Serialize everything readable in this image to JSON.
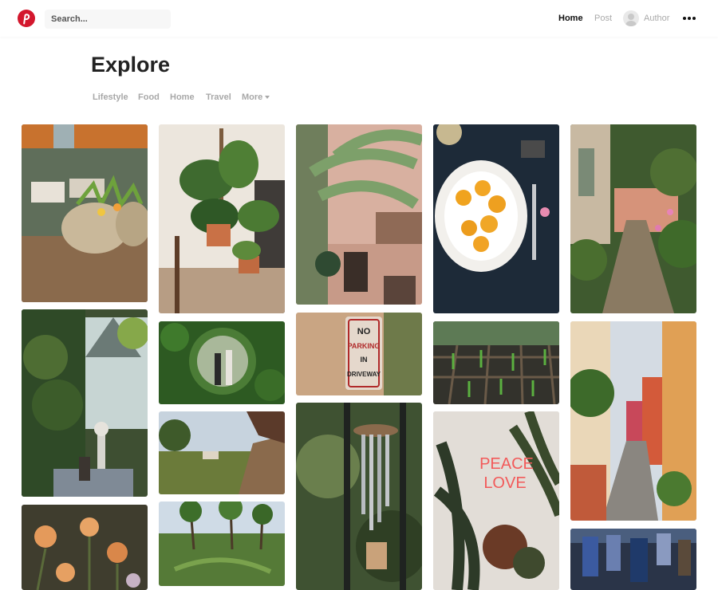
{
  "header": {
    "logo_icon": "pinterest-p-logo",
    "search_placeholder": "Search...",
    "nav": {
      "home": "Home",
      "post": "Post",
      "author": "Author"
    },
    "more_icon": "more-dots-icon",
    "accent_color": "#d3172d"
  },
  "main": {
    "title": "Explore",
    "categories": [
      "Lifestyle",
      "Food",
      "Home",
      "Travel",
      "More"
    ]
  },
  "gallery": {
    "tiles": [
      {
        "subject": "potted-plants-welcome-sign"
      },
      {
        "subject": "monstera-plant-corner"
      },
      {
        "subject": "palm-courtyard-cafe"
      },
      {
        "subject": "food-plate-fork"
      },
      {
        "subject": "cobblestone-garden-path"
      },
      {
        "subject": "greenhouse-garden"
      },
      {
        "subject": "round-hedge-window"
      },
      {
        "subject": "no-parking-sign"
      },
      {
        "subject": "seedling-tray"
      },
      {
        "subject": "colorful-street-alley"
      },
      {
        "subject": "countryside-path-house"
      },
      {
        "subject": "tropical-rice-terraces"
      },
      {
        "subject": "wind-chime"
      },
      {
        "subject": "peace-love-neon-sign"
      },
      {
        "subject": "orange-flowers"
      },
      {
        "subject": "hanging-clothes"
      }
    ]
  },
  "neon_text": [
    "PEACE",
    "LOVE"
  ],
  "sign_text": [
    "NO",
    "PARKING",
    "IN",
    "DRIVEWAY"
  ]
}
